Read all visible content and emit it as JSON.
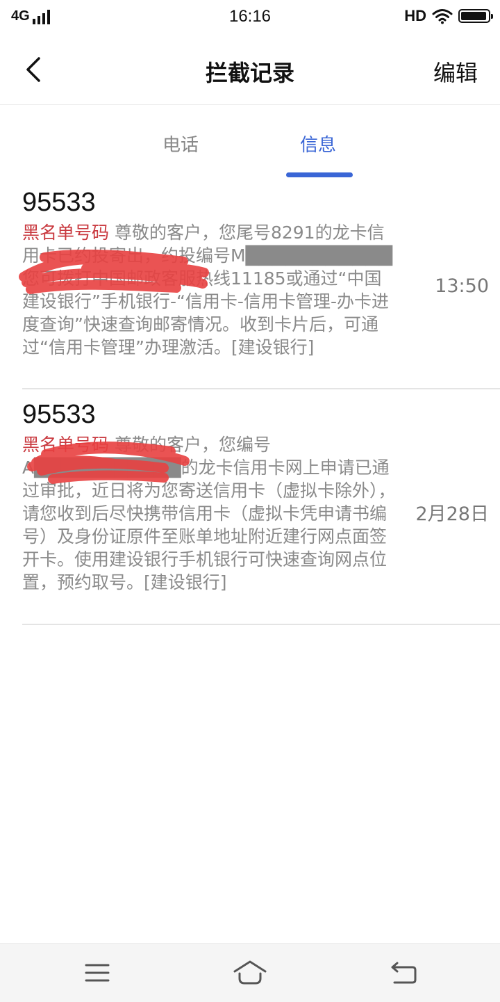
{
  "status_bar": {
    "network": "4G",
    "time": "16:16",
    "hd": "HD",
    "icons": [
      "signal-icon",
      "wifi-icon",
      "battery-icon"
    ]
  },
  "header": {
    "title": "拦截记录",
    "edit_label": "编辑",
    "back_icon": "chevron-left-icon"
  },
  "tabs": [
    {
      "label": "电话",
      "active": false
    },
    {
      "label": "信息",
      "active": true
    }
  ],
  "accent_color": "#3a66d6",
  "tag_color": "#c9393f",
  "messages": [
    {
      "sender": "95533",
      "tag": "黑名单号码",
      "body": " 尊敬的客户，您尾号8291的龙卡信用卡已约投寄出，约投编号M███████████ 您可拨打中国邮政客服热线11185或通过“中国建设银行”手机银行-“信用卡-信用卡管理-办卡进度查询”快速查询邮寄情况。收到卡片后，可通过“信用卡管理”办理激活。[建设银行]",
      "time": "13:50"
    },
    {
      "sender": "95533",
      "tag": "黑名单号码",
      "body": " 尊敬的客户，您编号A███████████的龙卡信用卡网上申请已通过审批，近日将为您寄送信用卡（虚拟卡除外），请您收到后尽快携带信用卡（虚拟卡凭申请书编号）及身份证原件至账单地址附近建行网点面签开卡。使用建设银行手机银行可快速查询网点位置，预约取号。[建设银行]",
      "time": "2月28日"
    }
  ],
  "nav_bar": {
    "icons": [
      "menu-icon",
      "home-icon",
      "back-arrow-icon"
    ]
  }
}
